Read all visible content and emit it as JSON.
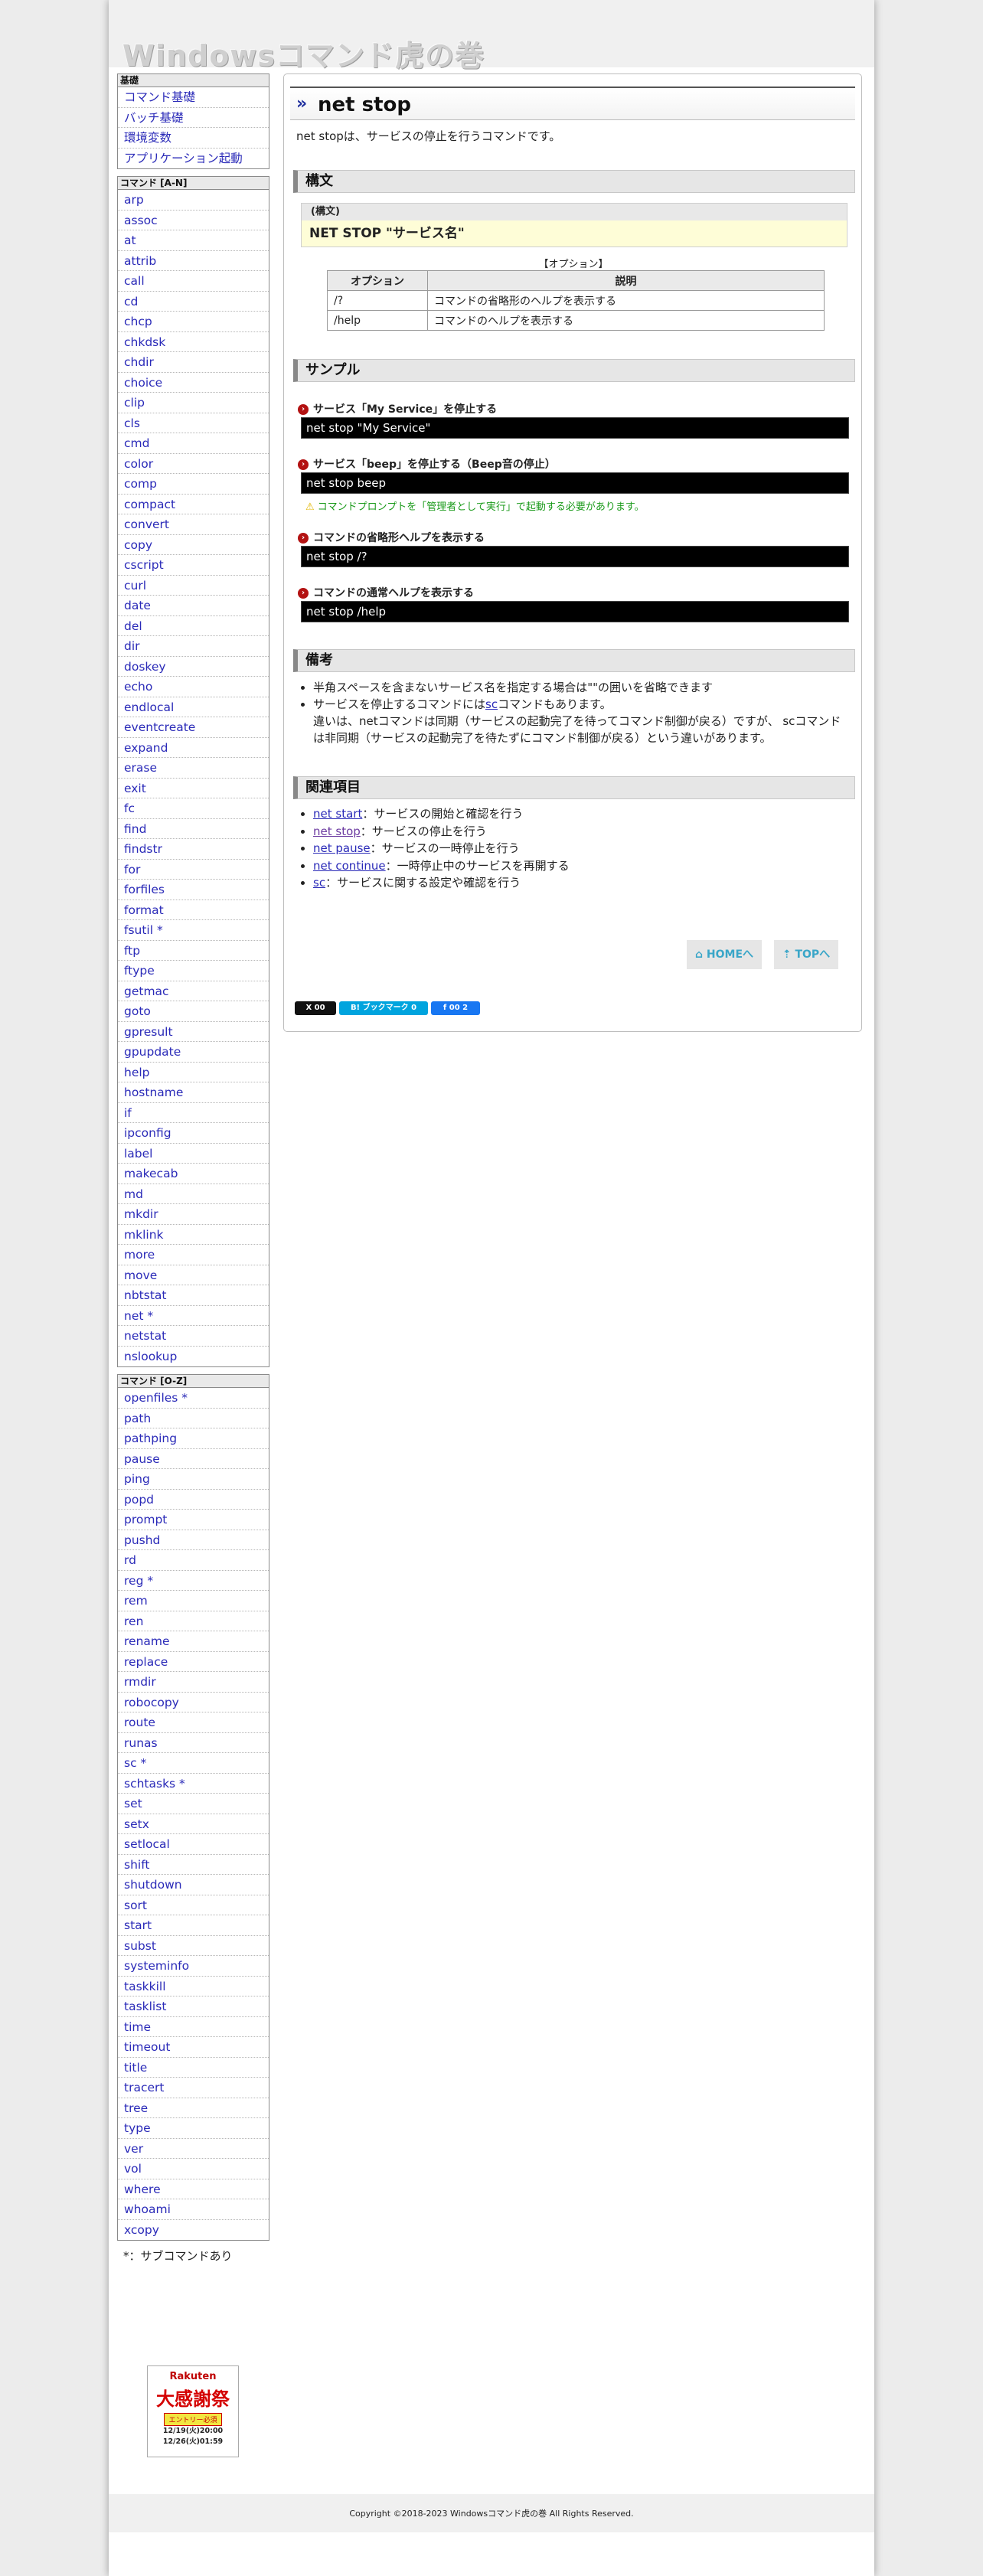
{
  "site_title": "Windowsコマンド虎の巻",
  "sidebar": {
    "kiso": {
      "heading": "基礎",
      "items": [
        "コマンド基礎",
        "バッチ基礎",
        "環境変数",
        "アプリケーション起動"
      ]
    },
    "an": {
      "heading": "コマンド [A-N]",
      "items": [
        "arp",
        "assoc",
        "at",
        "attrib",
        "call",
        "cd",
        "chcp",
        "chkdsk",
        "chdir",
        "choice",
        "clip",
        "cls",
        "cmd",
        "color",
        "comp",
        "compact",
        "convert",
        "copy",
        "cscript",
        "curl",
        "date",
        "del",
        "dir",
        "doskey",
        "echo",
        "endlocal",
        "eventcreate",
        "expand",
        "erase",
        "exit",
        "fc",
        "find",
        "findstr",
        "for",
        "forfiles",
        "format",
        "fsutil *",
        "ftp",
        "ftype",
        "getmac",
        "goto",
        "gpresult",
        "gpupdate",
        "help",
        "hostname",
        "if",
        "ipconfig",
        "label",
        "makecab",
        "md",
        "mkdir",
        "mklink",
        "more",
        "move",
        "nbtstat",
        "net *",
        "netstat",
        "nslookup"
      ]
    },
    "oz": {
      "heading": "コマンド [O-Z]",
      "items": [
        "openfiles *",
        "path",
        "pathping",
        "pause",
        "ping",
        "popd",
        "prompt",
        "pushd",
        "rd",
        "reg *",
        "rem",
        "ren",
        "rename",
        "replace",
        "rmdir",
        "robocopy",
        "route",
        "runas",
        "sc *",
        "schtasks *",
        "set",
        "setx",
        "setlocal",
        "shift",
        "shutdown",
        "sort",
        "start",
        "subst",
        "systeminfo",
        "taskkill",
        "tasklist",
        "time",
        "timeout",
        "title",
        "tracert",
        "tree",
        "type",
        "ver",
        "vol",
        "where",
        "whoami",
        "xcopy"
      ]
    },
    "note": "*：サブコマンドあり",
    "ad": {
      "brand": "Rakuten",
      "title": "大感謝祭",
      "tag": "エントリー必須",
      "date1": "12/19(火)20:00",
      "date2": "12/26(火)01:59"
    }
  },
  "main": {
    "title": "net stop",
    "intro": "net stopは、サービスの停止を行うコマンドです。",
    "syntax_section": "構文",
    "syntax_label": "(構文)",
    "syntax_value": "NET STOP \"サービス名\"",
    "options_caption": "【オプション】",
    "options_headers": [
      "オプション",
      "説明"
    ],
    "options": [
      {
        "opt": "/?",
        "desc": "コマンドの省略形のヘルプを表示する"
      },
      {
        "opt": "/help",
        "desc": "コマンドのヘルプを表示する"
      }
    ],
    "sample_section": "サンプル",
    "samples": [
      {
        "title": "サービス「My Service」を停止する",
        "code": "net stop \"My Service\""
      },
      {
        "title": "サービス「beep」を停止する（Beep音の停止）",
        "code": "net stop beep"
      },
      {
        "title": "コマンドの省略形ヘルプを表示する",
        "code": "net stop /?"
      },
      {
        "title": "コマンドの通常ヘルプを表示する",
        "code": "net stop /help"
      }
    ],
    "warning": "コマンドプロンプトを「管理者として実行」で起動する必要があります。",
    "notes_section": "備考",
    "notes": {
      "n1": "半角スペースを含まないサービス名を指定する場合は\"\"の囲いを省略できます",
      "n2_pre": "サービスを停止するコマンドには",
      "n2_link": "sc",
      "n2_post": "コマンドもあります。",
      "n2_line2": "違いは、netコマンドは同期（サービスの起動完了を待ってコマンド制御が戻る）ですが、 scコマンドは非同期（サービスの起動完了を待たずにコマンド制御が戻る）という違いがあります。"
    },
    "related_section": "関連項目",
    "related": [
      {
        "link": "net start",
        "desc": "：サービスの開始と確認を行う"
      },
      {
        "link": "net stop",
        "desc": "：サービスの停止を行う"
      },
      {
        "link": "net pause",
        "desc": "：サービスの一時停止を行う"
      },
      {
        "link": "net continue",
        "desc": "：一時停止中のサービスを再開する"
      },
      {
        "link": "sc",
        "desc": "：サービスに関する設定や確認を行う"
      }
    ],
    "home_button": "HOMEへ",
    "top_button": "TOPへ",
    "share": {
      "x": "X 00",
      "hatena": "B! ブックマーク 0",
      "facebook": "f 00 2"
    }
  },
  "footer": "Copyright ©2018-2023 Windowsコマンド虎の巻 All Rights Reserved.",
  "colors": {
    "link": "#2a2ab8",
    "code_bg": "#000000",
    "syntax_bg": "#fefdd7",
    "bullet": "#b31212",
    "warning": "#1a9a1a",
    "nav_text": "#3aa6c8"
  }
}
